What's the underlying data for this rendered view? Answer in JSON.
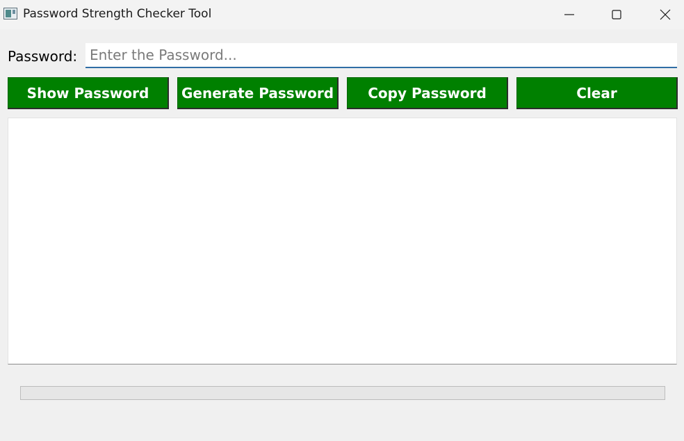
{
  "window": {
    "title": "Password Strength Checker Tool",
    "controls": [
      "minimize-icon",
      "maximize-icon",
      "close-icon"
    ]
  },
  "form": {
    "password_label": "Password:",
    "password_placeholder": "Enter the Password...",
    "password_value": ""
  },
  "buttons": {
    "show": "Show Password",
    "generate": "Generate Password",
    "copy": "Copy Password",
    "clear": "Clear"
  },
  "output": {
    "text": ""
  },
  "strength": {
    "progress": 0
  },
  "colors": {
    "button_bg": "#008000",
    "button_text": "#ffffff",
    "input_underline": "#2f6ea5"
  }
}
